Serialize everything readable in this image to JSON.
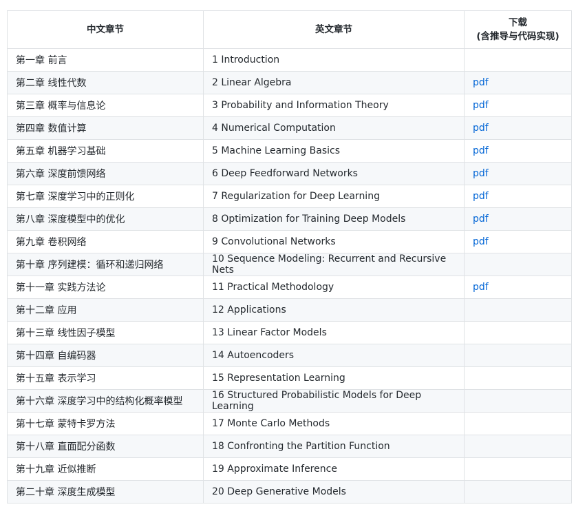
{
  "headers": {
    "zh": "中文章节",
    "en": "英文章节",
    "dl_line1": "下载",
    "dl_line2": "(含推导与代码实现)"
  },
  "rows": [
    {
      "zh": "第一章 前言",
      "en": "1 Introduction",
      "pdf": ""
    },
    {
      "zh": "第二章 线性代数",
      "en": "2 Linear Algebra",
      "pdf": "pdf"
    },
    {
      "zh": "第三章 概率与信息论",
      "en": "3 Probability and Information Theory",
      "pdf": "pdf"
    },
    {
      "zh": "第四章 数值计算",
      "en": "4 Numerical Computation",
      "pdf": "pdf"
    },
    {
      "zh": "第五章 机器学习基础",
      "en": "5 Machine Learning Basics",
      "pdf": "pdf"
    },
    {
      "zh": "第六章 深度前馈网络",
      "en": "6 Deep Feedforward Networks",
      "pdf": "pdf"
    },
    {
      "zh": "第七章 深度学习中的正则化",
      "en": "7 Regularization for Deep Learning",
      "pdf": "pdf"
    },
    {
      "zh": "第八章 深度模型中的优化",
      "en": "8 Optimization for Training Deep Models",
      "pdf": "pdf"
    },
    {
      "zh": "第九章 卷积网络",
      "en": "9 Convolutional Networks",
      "pdf": "pdf"
    },
    {
      "zh": "第十章 序列建模：循环和递归网络",
      "en": "10 Sequence Modeling: Recurrent and Recursive Nets",
      "pdf": ""
    },
    {
      "zh": "第十一章 实践方法论",
      "en": "11 Practical Methodology",
      "pdf": "pdf"
    },
    {
      "zh": "第十二章 应用",
      "en": "12 Applications",
      "pdf": ""
    },
    {
      "zh": "第十三章 线性因子模型",
      "en": "13 Linear Factor Models",
      "pdf": ""
    },
    {
      "zh": "第十四章 自编码器",
      "en": "14 Autoencoders",
      "pdf": ""
    },
    {
      "zh": "第十五章 表示学习",
      "en": "15 Representation Learning",
      "pdf": ""
    },
    {
      "zh": "第十六章 深度学习中的结构化概率模型",
      "en": "16 Structured Probabilistic Models for Deep Learning",
      "pdf": ""
    },
    {
      "zh": "第十七章 蒙特卡罗方法",
      "en": "17 Monte Carlo Methods",
      "pdf": ""
    },
    {
      "zh": "第十八章 直面配分函数",
      "en": "18 Confronting the Partition Function",
      "pdf": ""
    },
    {
      "zh": "第十九章 近似推断",
      "en": "19 Approximate Inference",
      "pdf": ""
    },
    {
      "zh": "第二十章 深度生成模型",
      "en": "20 Deep Generative Models",
      "pdf": ""
    }
  ]
}
